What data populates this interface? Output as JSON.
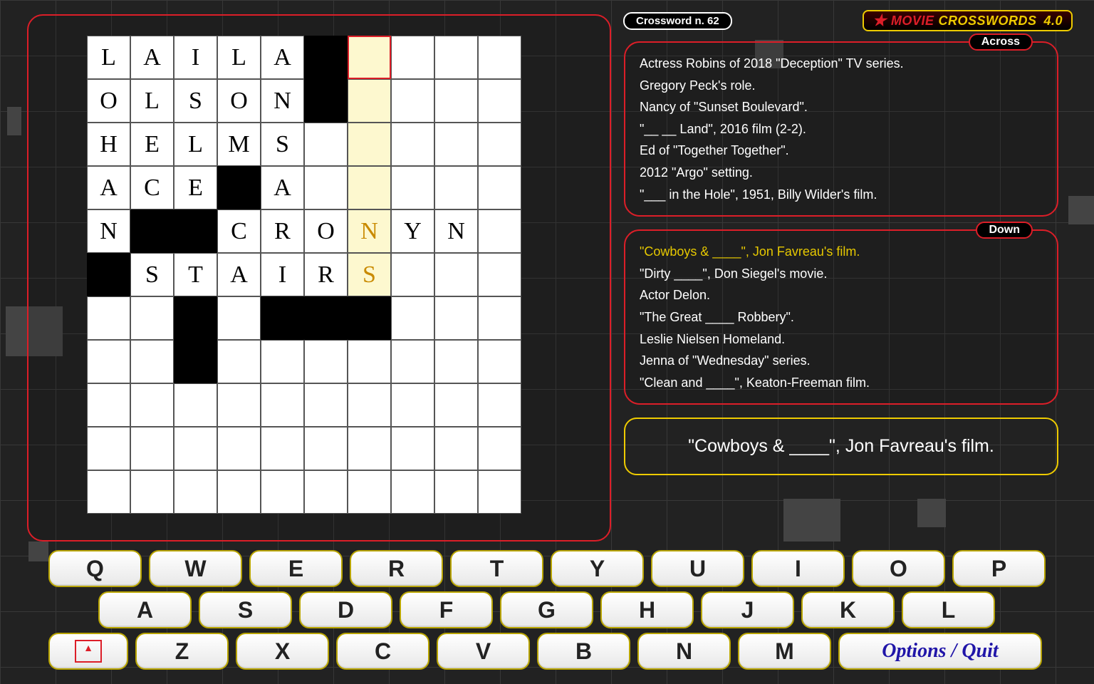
{
  "header": {
    "crossword_label": "Crossword n. 62",
    "brand_text_1": "MOVIE",
    "brand_text_2": "CROSSWORDS",
    "brand_version": "4.0"
  },
  "grid": {
    "cols": 10,
    "rows": 11,
    "cells": [
      [
        "L",
        "A",
        "I",
        "L",
        "A",
        "#",
        "hc",
        "",
        "",
        ""
      ],
      [
        "O",
        "L",
        "S",
        "O",
        "N",
        "#",
        "h",
        "",
        "",
        ""
      ],
      [
        "H",
        "E",
        "L",
        "M",
        "S",
        "",
        "h",
        "",
        "",
        ""
      ],
      [
        "A",
        "C",
        "E",
        "#",
        "A",
        "",
        "h",
        "",
        "",
        ""
      ],
      [
        "N",
        "#",
        "#",
        "C",
        "R",
        "O",
        "hN",
        "Y",
        "N",
        ""
      ],
      [
        "#",
        "S",
        "T",
        "A",
        "I",
        "R",
        "hS",
        "",
        "",
        ""
      ],
      [
        "",
        "",
        "#",
        "",
        "#",
        "#",
        "#",
        "",
        "",
        ""
      ],
      [
        "",
        "",
        "#",
        "",
        "",
        "",
        "",
        "",
        "",
        ""
      ],
      [
        "",
        "",
        "",
        "",
        "",
        "",
        "",
        "",
        "",
        ""
      ],
      [
        "",
        "",
        "",
        "",
        "",
        "",
        "",
        "",
        "",
        ""
      ],
      [
        "",
        "",
        "",
        "",
        "",
        "",
        "",
        "",
        "",
        ""
      ]
    ]
  },
  "across": {
    "title": "Across",
    "clues": [
      "Actress Robins of 2018 \"Deception\" TV series.",
      "Gregory Peck's role.",
      "Nancy of \"Sunset Boulevard\".",
      "\"__ __ Land\", 2016 film (2-2).",
      "Ed of \"Together Together\".",
      "2012 \"Argo\" setting.",
      "\"___ in the Hole\", 1951, Billy Wilder's film."
    ]
  },
  "down": {
    "title": "Down",
    "selected_index": 0,
    "clues": [
      "\"Cowboys & ____\", Jon Favreau's film.",
      "\"Dirty ____\", Don Siegel's movie.",
      "Actor Delon.",
      "\"The Great ____ Robbery\".",
      "Leslie Nielsen Homeland.",
      "Jenna of \"Wednesday\" series.",
      "\"Clean and ____\", Keaton-Freeman film."
    ]
  },
  "current_clue": "\"Cowboys & ____\", Jon Favreau's film.",
  "keyboard": {
    "row1": [
      "Q",
      "W",
      "E",
      "R",
      "T",
      "Y",
      "U",
      "I",
      "O",
      "P"
    ],
    "row2": [
      "A",
      "S",
      "D",
      "F",
      "G",
      "H",
      "J",
      "K",
      "L"
    ],
    "row3": [
      "Z",
      "X",
      "C",
      "V",
      "B",
      "N",
      "M"
    ],
    "options_label": "Options / Quit"
  }
}
